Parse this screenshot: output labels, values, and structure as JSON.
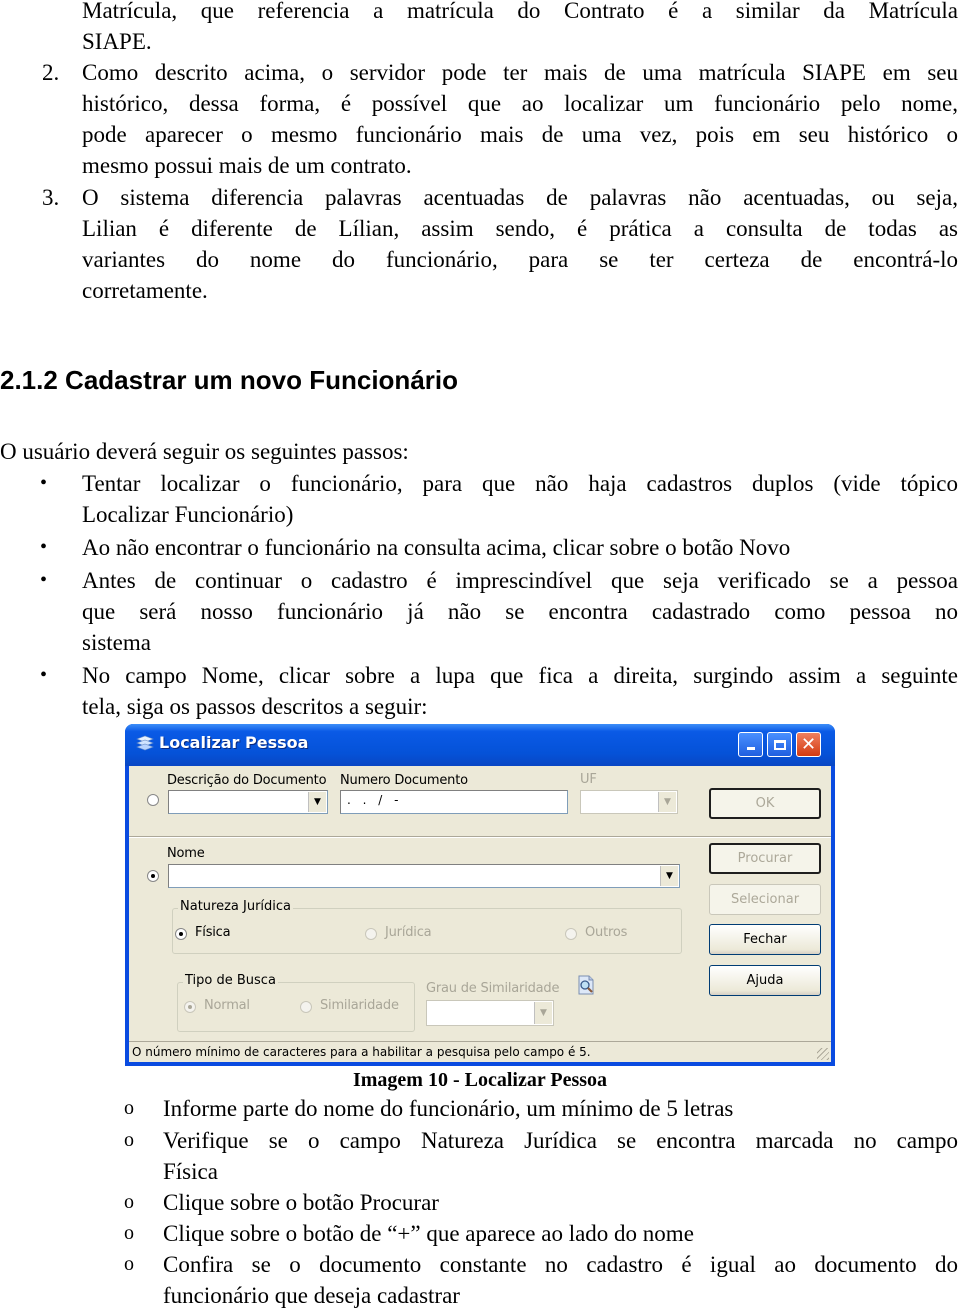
{
  "document": {
    "intro_continuation": [
      "Matrícula, que referencia a matrícula do Contrato é a similar da Matrícula",
      "SIAPE."
    ],
    "numbered_items": [
      {
        "number": "2.",
        "lines": [
          "Como descrito acima, o servidor pode ter mais de uma matrícula SIAPE em seu",
          "histórico, dessa forma, é possível que ao localizar um funcionário pelo nome,",
          "pode aparecer o mesmo funcionário mais de uma vez, pois em seu histórico o",
          "mesmo possui mais de um contrato."
        ]
      },
      {
        "number": "3.",
        "lines": [
          "O sistema diferencia palavras acentuadas de palavras não acentuadas, ou seja,",
          "Lilian é diferente de Lílian, assim sendo, é prática a consulta de todas as",
          "variantes do nome do funcionário, para se ter certeza de encontrá-lo",
          "corretamente."
        ]
      }
    ],
    "section_heading": "2.1.2 Cadastrar um novo Funcionário",
    "steps_intro": "O usuário deverá seguir os seguintes passos:",
    "bullets": [
      {
        "marker": "•",
        "lines": [
          "Tentar localizar o funcionário, para que não haja cadastros duplos (vide tópico",
          "Localizar Funcionário)"
        ]
      },
      {
        "marker": "•",
        "lines": [
          "Ao não encontrar o funcionário na consulta acima, clicar sobre o botão Novo"
        ]
      },
      {
        "marker": "•",
        "lines": [
          "Antes de continuar o cadastro é imprescindível que seja verificado se a pessoa",
          "que será nosso funcionário já não se encontra cadastrado como pessoa no",
          "sistema"
        ]
      },
      {
        "marker": "•",
        "lines": [
          "No campo Nome, clicar sobre a lupa que fica a direita, surgindo assim a seguinte",
          "tela, siga os passos descritos a seguir:"
        ]
      }
    ],
    "figure_caption": "Imagem 10 - Localizar Pessoa",
    "sub_steps": [
      {
        "marker": "o",
        "lines": [
          "Informe parte do nome do funcionário, um mínimo de 5 letras"
        ]
      },
      {
        "marker": "o",
        "lines": [
          "Verifique se o campo Natureza Jurídica se encontra marcada no campo",
          "Física"
        ]
      },
      {
        "marker": "o",
        "lines": [
          "Clique sobre o botão Procurar"
        ]
      },
      {
        "marker": "o",
        "lines": [
          "Clique sobre o botão de “+” que aparece ao lado do nome"
        ]
      },
      {
        "marker": "o",
        "lines": [
          "Confira se o documento constante no cadastro é igual ao documento do",
          "funcionário que deseja cadastrar"
        ]
      }
    ]
  },
  "dialog": {
    "title": "Localizar Pessoa",
    "title_icon": "stack-layers-icon",
    "window_buttons": {
      "minimize": "_",
      "maximize": "□",
      "close": "✕"
    },
    "doc_search": {
      "selected": false,
      "descricao_label": "Descrição do Documento",
      "descricao_value": "",
      "numero_label": "Numero Documento",
      "numero_mask": ". . / -",
      "uf_label": "UF",
      "uf_value": ""
    },
    "name_search": {
      "selected": true,
      "nome_label": "Nome",
      "nome_value": ""
    },
    "natureza_juridica": {
      "label": "Natureza Jurídica",
      "options": [
        {
          "label": "Física",
          "selected": true,
          "enabled": true
        },
        {
          "label": "Jurídica",
          "selected": false,
          "enabled": false
        },
        {
          "label": "Outros",
          "selected": false,
          "enabled": false
        }
      ]
    },
    "tipo_busca": {
      "label": "Tipo de Busca",
      "options": [
        {
          "label": "Normal",
          "selected": true,
          "enabled": false
        },
        {
          "label": "Similaridade",
          "selected": false,
          "enabled": false
        }
      ]
    },
    "grau_similaridade": {
      "label": "Grau de Similaridade",
      "value": ""
    },
    "buttons": {
      "ok": "OK",
      "procurar": "Procurar",
      "selecionar": "Selecionar",
      "fechar": "Fechar",
      "ajuda": "Ajuda"
    },
    "status_text": "O número mínimo de caracteres para a habilitar a pesquisa pelo campo  é 5."
  }
}
